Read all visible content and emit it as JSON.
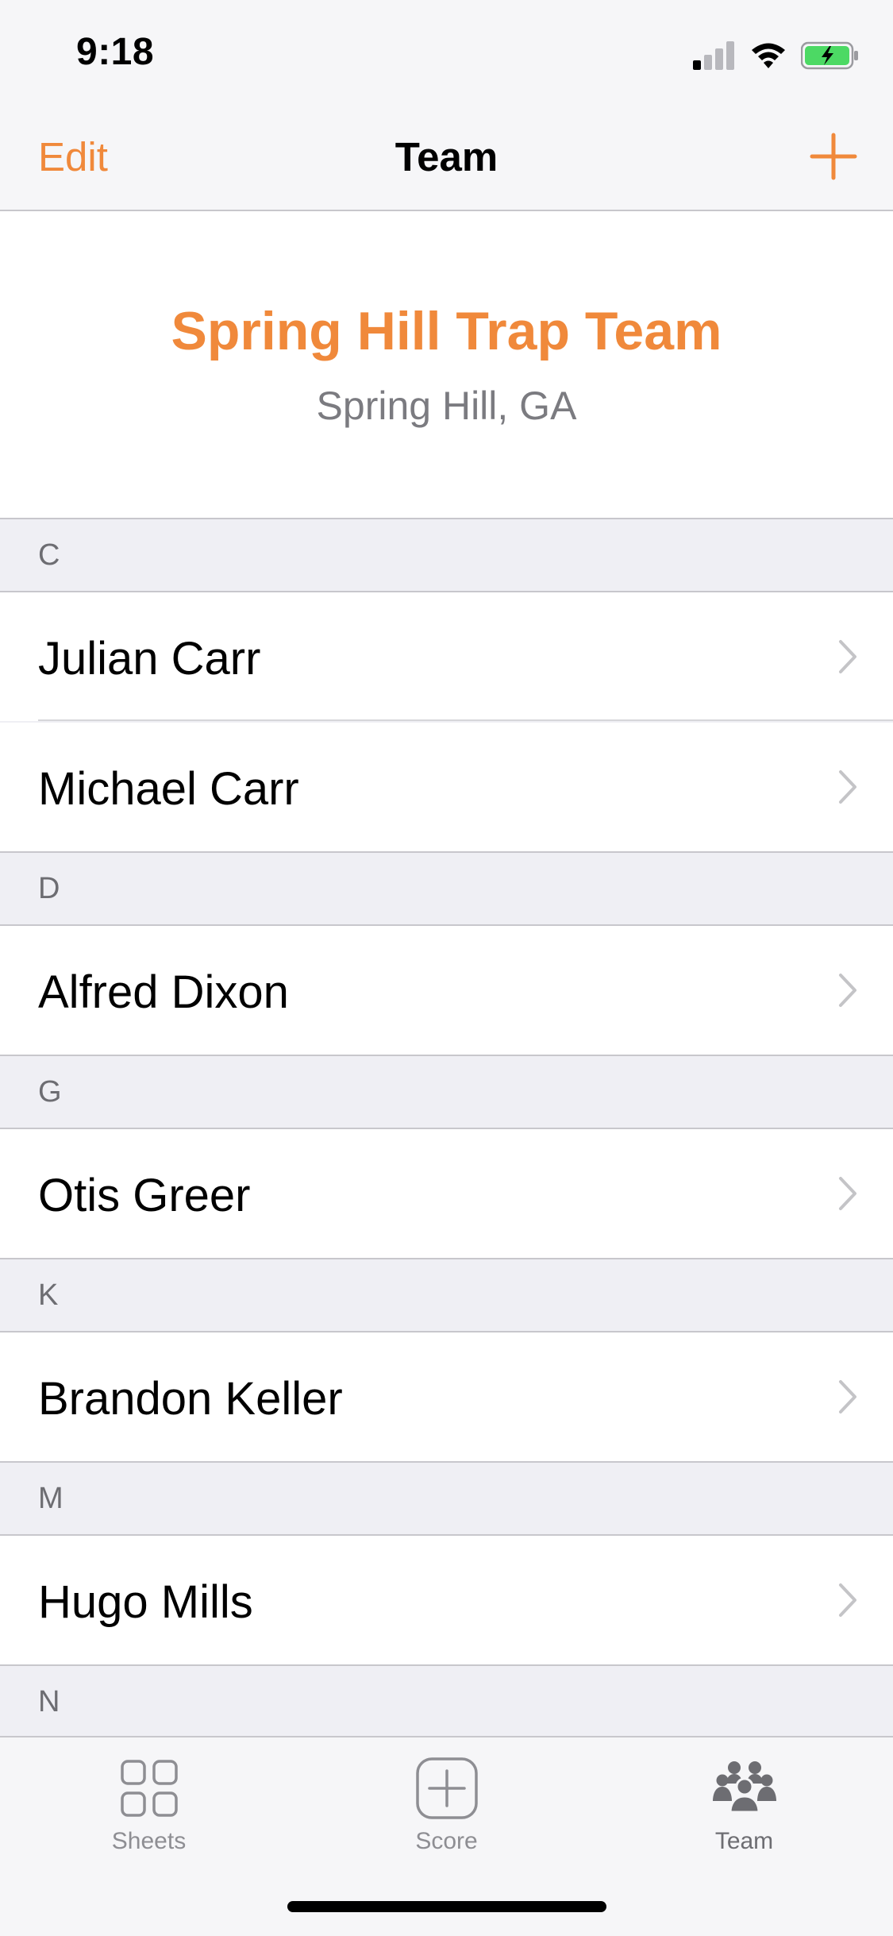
{
  "status_bar": {
    "time": "9:18"
  },
  "nav": {
    "edit_label": "Edit",
    "title": "Team"
  },
  "team": {
    "name": "Spring Hill Trap Team",
    "location": "Spring Hill, GA"
  },
  "sections": [
    {
      "letter": "C",
      "members": [
        "Julian Carr",
        "Michael Carr"
      ]
    },
    {
      "letter": "D",
      "members": [
        "Alfred Dixon"
      ]
    },
    {
      "letter": "G",
      "members": [
        "Otis Greer"
      ]
    },
    {
      "letter": "K",
      "members": [
        "Brandon Keller"
      ]
    },
    {
      "letter": "M",
      "members": [
        "Hugo Mills"
      ]
    },
    {
      "letter": "N",
      "members": []
    }
  ],
  "tabs": [
    {
      "label": "Sheets",
      "icon": "grid-icon"
    },
    {
      "label": "Score",
      "icon": "plus-square-icon"
    },
    {
      "label": "Team",
      "icon": "people-icon",
      "active": true
    }
  ],
  "colors": {
    "accent": "#f0893b",
    "secondary_text": "#7b7b80",
    "section_bg": "#efeff4"
  }
}
